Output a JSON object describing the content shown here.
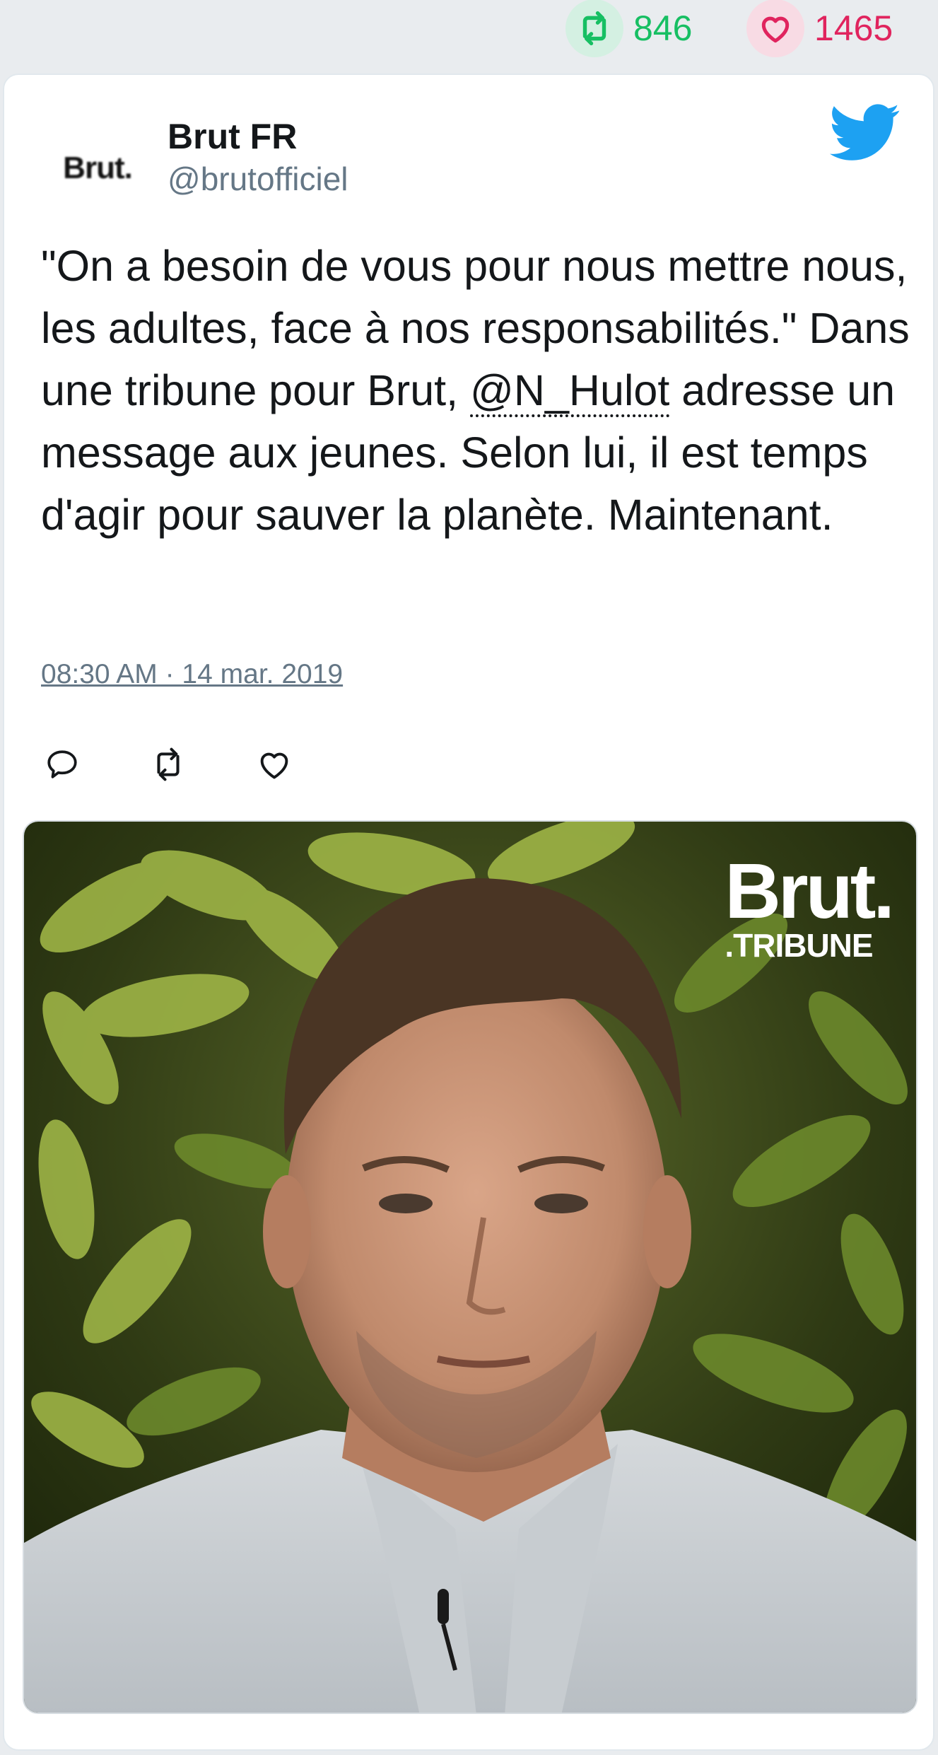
{
  "stats": {
    "retweet_count": "846",
    "like_count": "1465",
    "retweet_icon": "retweet-icon",
    "like_icon": "heart-icon",
    "retweet_color": "#17bf63",
    "like_color": "#e0245e"
  },
  "author": {
    "avatar_text": "Brut.",
    "name": "Brut FR",
    "handle": "@brutofficiel",
    "platform_icon": "twitter-bird-icon"
  },
  "tweet": {
    "text_before": "\"On a besoin de vous pour nous mettre nous, les adultes, face à nos responsabilités.\" Dans une tribune pour Brut, ",
    "mention": "@N_Hulot",
    "text_after": " adresse un message aux jeunes. Selon lui, il est temps d'agir pour sauver la planète. Maintenant.",
    "timestamp": "08:30 AM · 14 mar. 2019"
  },
  "actions": {
    "reply_icon": "reply-icon",
    "retweet_icon": "retweet-icon",
    "like_icon": "heart-icon"
  },
  "media": {
    "overlay_main": "Brut.",
    "overlay_sub": ".TRIBUNE"
  },
  "colors": {
    "background": "#e9ecef",
    "card": "#ffffff",
    "text": "#14171a",
    "muted": "#657786",
    "twitter_blue": "#1da1f2"
  }
}
